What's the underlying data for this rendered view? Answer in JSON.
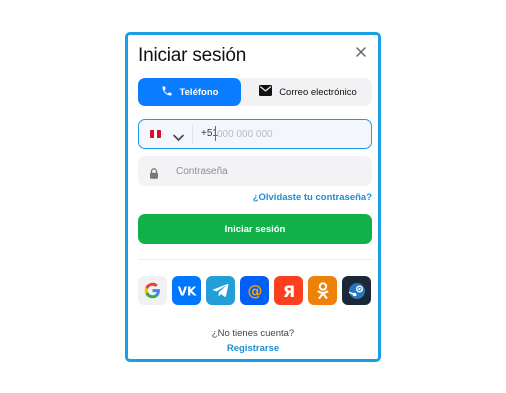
{
  "modal": {
    "title": "Iniciar sesión",
    "close_icon": "close-icon"
  },
  "tabs": [
    {
      "label": "Teléfono",
      "icon": "phone-icon",
      "active": true
    },
    {
      "label": "Correo electrónico",
      "icon": "envelope-icon",
      "active": false
    }
  ],
  "phone": {
    "country_flag": "peru-flag-icon",
    "prefix": "+51",
    "placeholder": "000 000 000",
    "value": ""
  },
  "password": {
    "placeholder": "Contraseña",
    "icon": "lock-icon"
  },
  "forgot_link": "¿Olvidaste tu contraseña?",
  "login_button": "Iniciar sesión",
  "social": [
    {
      "name": "google",
      "icon": "google-icon",
      "color": "#f1f1f1"
    },
    {
      "name": "vk",
      "icon": "vk-icon",
      "color": "#0077ff"
    },
    {
      "name": "telegram",
      "icon": "telegram-icon",
      "color": "#229ed9"
    },
    {
      "name": "mail-ru",
      "icon": "mail-ru-icon",
      "color": "#005ff9"
    },
    {
      "name": "yandex",
      "icon": "yandex-icon",
      "color": "#fc3f1d"
    },
    {
      "name": "odnoklassniki",
      "icon": "odnoklassniki-icon",
      "color": "#ee8208"
    },
    {
      "name": "steam",
      "icon": "steam-icon",
      "color": "#1b2838"
    }
  ],
  "footer": {
    "no_account": "¿No tienes cuenta?",
    "register_link": "Registrarse"
  },
  "colors": {
    "accent_blue": "#0a7cff",
    "border_blue": "#1a9fe6",
    "link_blue": "#1a8fd8",
    "login_green": "#12b049"
  }
}
